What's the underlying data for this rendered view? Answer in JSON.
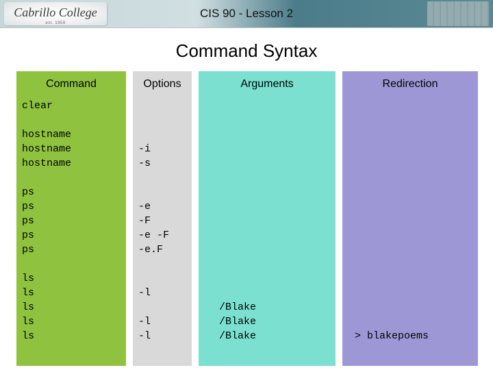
{
  "header": {
    "logo_text": "Cabrillo College",
    "logo_sub": "est. 1959",
    "title": "CIS 90 - Lesson 2"
  },
  "main_title": "Command Syntax",
  "columns": {
    "command": {
      "header": "Command"
    },
    "options": {
      "header": "Options"
    },
    "arguments": {
      "header": "Arguments"
    },
    "redirection": {
      "header": "Redirection"
    }
  },
  "rows": [
    {
      "cmd": "clear",
      "opt": "",
      "arg": "",
      "redir": ""
    },
    {
      "cmd": "",
      "opt": "",
      "arg": "",
      "redir": ""
    },
    {
      "cmd": "hostname",
      "opt": "",
      "arg": "",
      "redir": ""
    },
    {
      "cmd": "hostname",
      "opt": "-i",
      "arg": "",
      "redir": ""
    },
    {
      "cmd": "hostname",
      "opt": "-s",
      "arg": "",
      "redir": ""
    },
    {
      "cmd": "",
      "opt": "",
      "arg": "",
      "redir": ""
    },
    {
      "cmd": "ps",
      "opt": "",
      "arg": "",
      "redir": ""
    },
    {
      "cmd": "ps",
      "opt": "-e",
      "arg": "",
      "redir": ""
    },
    {
      "cmd": "ps",
      "opt": "-F",
      "arg": "",
      "redir": ""
    },
    {
      "cmd": "ps",
      "opt": "-e -F",
      "arg": "",
      "redir": ""
    },
    {
      "cmd": "ps",
      "opt": "-e.F",
      "arg": "",
      "redir": ""
    },
    {
      "cmd": "",
      "opt": "",
      "arg": "",
      "redir": ""
    },
    {
      "cmd": "ls",
      "opt": "",
      "arg": "",
      "redir": ""
    },
    {
      "cmd": "ls",
      "opt": "-l",
      "arg": "",
      "redir": ""
    },
    {
      "cmd": "ls",
      "opt": "",
      "arg": "/Blake",
      "redir": ""
    },
    {
      "cmd": "ls",
      "opt": "-l",
      "arg": "/Blake",
      "redir": ""
    },
    {
      "cmd": "ls",
      "opt": "-l",
      "arg": "/Blake",
      "redir": "> blakepoems"
    }
  ]
}
